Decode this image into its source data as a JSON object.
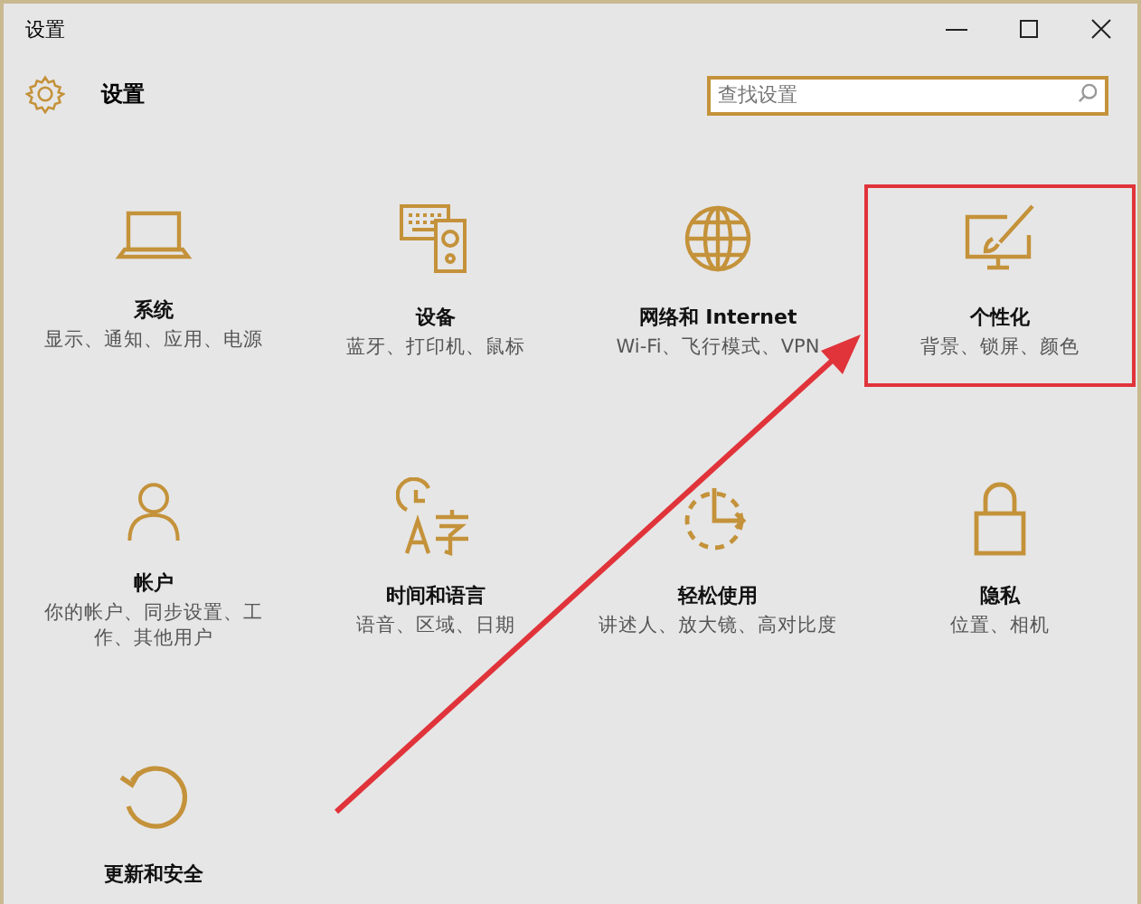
{
  "window": {
    "title": "设置"
  },
  "header": {
    "title": "设置"
  },
  "search": {
    "placeholder": "查找设置"
  },
  "tiles": [
    {
      "title": "系统",
      "description": "显示、通知、应用、电源",
      "highlighted": false
    },
    {
      "title": "设备",
      "description": "蓝牙、打印机、鼠标",
      "highlighted": false
    },
    {
      "title": "网络和 Internet",
      "description": "Wi-Fi、飞行模式、VPN",
      "highlighted": false
    },
    {
      "title": "个性化",
      "description": "背景、锁屏、颜色",
      "highlighted": true
    },
    {
      "title": "帐户",
      "description": "你的帐户、同步设置、工作、其他用户",
      "highlighted": false
    },
    {
      "title": "时间和语言",
      "description": "语音、区域、日期",
      "highlighted": false
    },
    {
      "title": "轻松使用",
      "description": "讲述人、放大镜、高对比度",
      "highlighted": false
    },
    {
      "title": "隐私",
      "description": "位置、相机",
      "highlighted": false
    },
    {
      "title": "更新和安全",
      "highlighted": false
    }
  ]
}
